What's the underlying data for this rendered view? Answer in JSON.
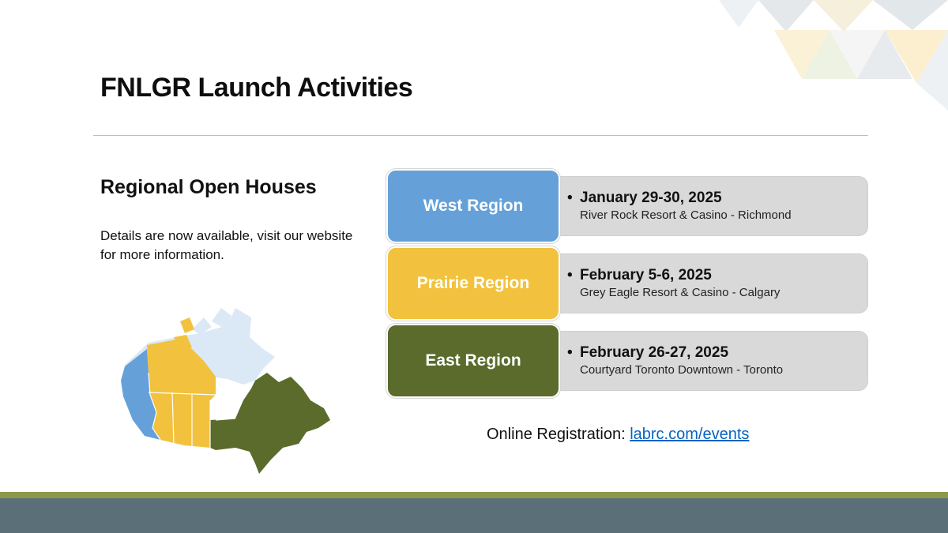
{
  "title": "FNLGR Launch Activities",
  "subheading": "Regional Open Houses",
  "description": "Details are now available, visit our website for more information.",
  "regions": [
    {
      "name": "West Region",
      "date": "January 29-30, 2025",
      "venue": "River Rock Resort & Casino - Richmond",
      "color": "#65a1d8"
    },
    {
      "name": "Prairie Region",
      "date": "February 5-6, 2025",
      "venue": "Grey Eagle Resort & Casino - Calgary",
      "color": "#f2c23e"
    },
    {
      "name": "East Region",
      "date": "February 26-27, 2025",
      "venue": "Courtyard Toronto Downtown - Toronto",
      "color": "#5a6b2c"
    }
  ],
  "registration": {
    "label": "Online Registration: ",
    "link_text": "labrc.com/events"
  },
  "colors": {
    "footer_green": "#8a9a4a",
    "footer_slate": "#5b6f79",
    "detail_bg": "#d9d9d9"
  },
  "icons": {
    "map": "canada-regions-map-icon"
  }
}
